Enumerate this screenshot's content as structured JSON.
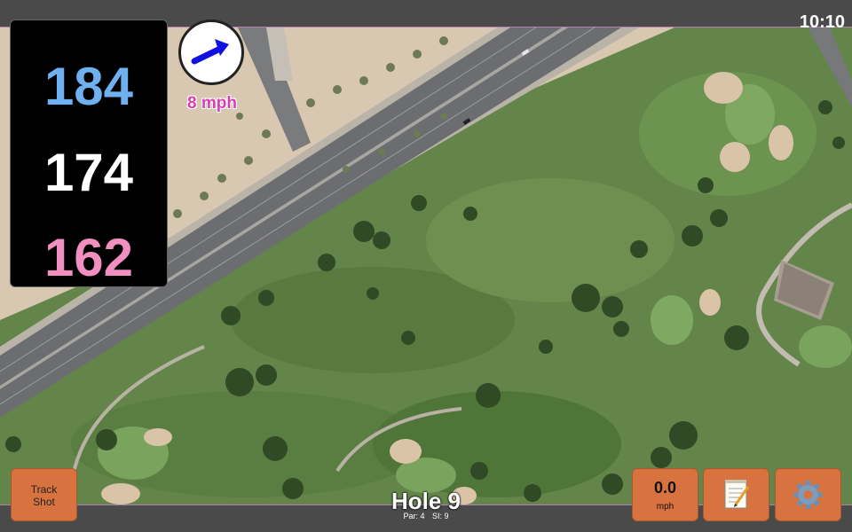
{
  "status": {
    "time": "10:10"
  },
  "distances": {
    "back": "184",
    "middle": "174",
    "front": "162"
  },
  "wind": {
    "speed_label": "8 mph",
    "icon": "arrow-up-right-icon",
    "arrow_color": "#1010e0"
  },
  "hole": {
    "title": "Hole 9",
    "par_label": "Par: 4",
    "si_label": "SI: 9"
  },
  "buttons": {
    "track_shot_line1": "Track",
    "track_shot_line2": "Shot",
    "speed_value": "0.0",
    "speed_unit": "mph",
    "notes_icon": "notepad-icon",
    "settings_icon": "gear-icon"
  },
  "colors": {
    "back_distance": "#6fb0f0",
    "middle_distance": "#ffffff",
    "front_distance": "#f08fc0",
    "button_bg": "#d8733f",
    "wind_label": "#d83fb0"
  }
}
